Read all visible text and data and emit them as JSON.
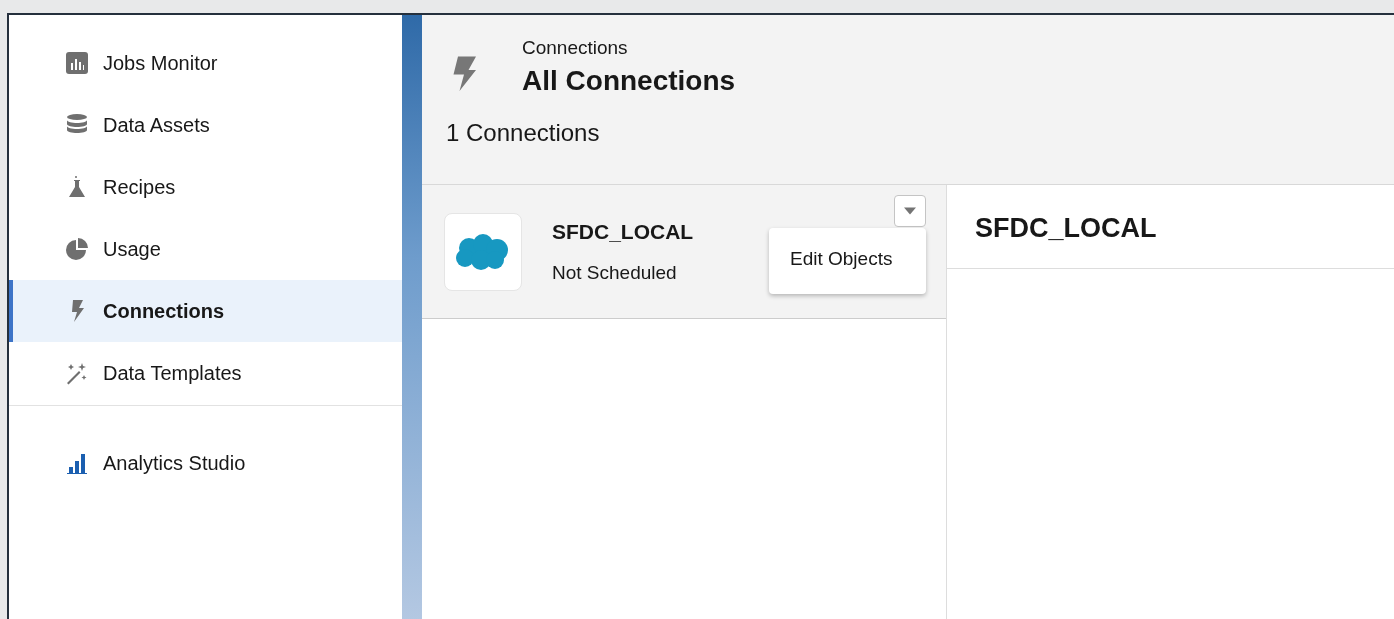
{
  "sidebar": {
    "groups": [
      {
        "items": [
          {
            "label": "Jobs Monitor",
            "selected": false
          },
          {
            "label": "Data Assets",
            "selected": false
          },
          {
            "label": "Recipes",
            "selected": false
          },
          {
            "label": "Usage",
            "selected": false
          },
          {
            "label": "Connections",
            "selected": true
          },
          {
            "label": "Data Templates",
            "selected": false
          }
        ]
      },
      {
        "items": [
          {
            "label": "Analytics Studio",
            "selected": false
          }
        ]
      }
    ]
  },
  "header": {
    "breadcrumb": "Connections",
    "title": "All Connections",
    "count": "1 Connections"
  },
  "connections": [
    {
      "name": "SFDC_LOCAL",
      "status": "Not Scheduled",
      "selected": true,
      "menu": {
        "expanded": true,
        "items": [
          "Edit Objects"
        ]
      }
    }
  ],
  "detail": {
    "title": "SFDC_LOCAL"
  }
}
